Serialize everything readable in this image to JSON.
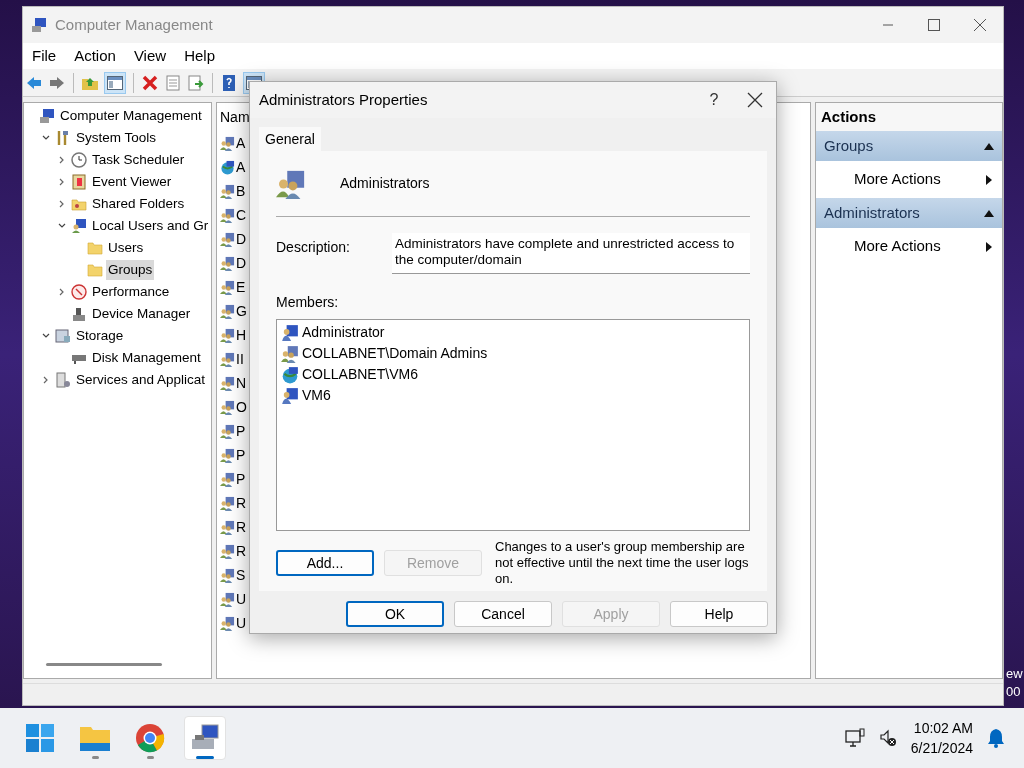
{
  "window": {
    "title": "Computer Management"
  },
  "menu": [
    "File",
    "Action",
    "View",
    "Help"
  ],
  "toolbar": [
    {
      "kind": "back"
    },
    {
      "kind": "forward"
    },
    {
      "kind": "sep"
    },
    {
      "kind": "folder-up"
    },
    {
      "kind": "pane",
      "selected": true
    },
    {
      "kind": "sep"
    },
    {
      "kind": "delete"
    },
    {
      "kind": "properties"
    },
    {
      "kind": "export"
    },
    {
      "kind": "sep"
    },
    {
      "kind": "help"
    },
    {
      "kind": "pane",
      "selected": true
    }
  ],
  "tree": [
    {
      "label": "Computer Management",
      "kind": "computer",
      "selected": false,
      "children": [
        {
          "label": "System Tools",
          "kind": "tools",
          "expanded": true,
          "selected": false,
          "children": [
            {
              "label": "Task Scheduler",
              "kind": "clock",
              "expanded": false,
              "selected": false
            },
            {
              "label": "Event Viewer",
              "kind": "log",
              "expanded": false,
              "selected": false
            },
            {
              "label": "Shared Folders",
              "kind": "share",
              "expanded": false,
              "selected": false
            },
            {
              "label": "Local Users and Gr",
              "kind": "users",
              "expanded": true,
              "selected": false,
              "children": [
                {
                  "label": "Users",
                  "kind": "folder",
                  "selected": false
                },
                {
                  "label": "Groups",
                  "kind": "folder",
                  "selected": true
                }
              ]
            },
            {
              "label": "Performance",
              "kind": "perf",
              "expanded": false,
              "selected": false
            },
            {
              "label": "Device Manager",
              "kind": "device",
              "selected": false
            }
          ]
        },
        {
          "label": "Storage",
          "kind": "storage",
          "expanded": true,
          "selected": false,
          "children": [
            {
              "label": "Disk Management",
              "kind": "disk",
              "selected": false
            }
          ]
        },
        {
          "label": "Services and Applicat",
          "kind": "services",
          "expanded": false,
          "selected": false
        }
      ]
    }
  ],
  "list": {
    "column_1": "Nam",
    "rows": [
      {
        "name": "A",
        "kind": "group"
      },
      {
        "name": "A",
        "kind": "domain"
      },
      {
        "name": "B",
        "kind": "group"
      },
      {
        "name": "C",
        "kind": "group"
      },
      {
        "name": "D",
        "kind": "group"
      },
      {
        "name": "D",
        "kind": "group"
      },
      {
        "name": "E",
        "kind": "group"
      },
      {
        "name": "G",
        "kind": "group"
      },
      {
        "name": "H",
        "kind": "group"
      },
      {
        "name": "II",
        "kind": "group"
      },
      {
        "name": "N",
        "kind": "group"
      },
      {
        "name": "O",
        "kind": "group"
      },
      {
        "name": "P",
        "kind": "group"
      },
      {
        "name": "P",
        "kind": "group"
      },
      {
        "name": "P",
        "kind": "group"
      },
      {
        "name": "R",
        "kind": "group"
      },
      {
        "name": "R",
        "kind": "group"
      },
      {
        "name": "R",
        "kind": "group"
      },
      {
        "name": "S",
        "kind": "group"
      },
      {
        "name": "U",
        "kind": "group"
      },
      {
        "name": "U",
        "kind": "group"
      }
    ]
  },
  "actions": {
    "title": "Actions",
    "sections": [
      {
        "header": "Groups",
        "expanded": true,
        "items": [
          "More Actions"
        ]
      },
      {
        "header": "Administrators",
        "expanded": true,
        "items": [
          "More Actions"
        ]
      }
    ]
  },
  "dialog": {
    "title": "Administrators Properties",
    "help": "?",
    "tabs": [
      {
        "label": "General",
        "selected": true
      }
    ],
    "group_name": "Administrators",
    "description_label": "Description:",
    "description": "Administrators have complete and unrestricted access to the computer/domain",
    "members_label": "Members:",
    "members": [
      {
        "name": "Administrator",
        "kind": "user"
      },
      {
        "name": "COLLABNET\\Domain Admins",
        "kind": "group"
      },
      {
        "name": "COLLABNET\\VM6",
        "kind": "domain"
      },
      {
        "name": "VM6",
        "kind": "user"
      }
    ],
    "member_buttons": [
      {
        "label": "Add...",
        "disabled": false,
        "focused": true
      },
      {
        "label": "Remove",
        "disabled": true,
        "focused": false
      }
    ],
    "note": "Changes to a user's group membership are not effective until the next time the user logs on.",
    "buttons": [
      {
        "label": "OK",
        "disabled": false,
        "focused": true
      },
      {
        "label": "Cancel",
        "disabled": false,
        "focused": false
      },
      {
        "label": "Apply",
        "disabled": true,
        "focused": false
      },
      {
        "label": "Help",
        "disabled": false,
        "focused": false
      }
    ]
  },
  "desktop_fragments": [
    "ew",
    "00"
  ],
  "taskbar": {
    "apps": [
      {
        "kind": "start",
        "active": false
      },
      {
        "kind": "explorer",
        "active": false,
        "running": true
      },
      {
        "kind": "chrome",
        "active": false,
        "running": true
      },
      {
        "kind": "compmgmt",
        "active": true,
        "running": true
      }
    ],
    "time": "10:02 AM",
    "date": "6/21/2024"
  }
}
